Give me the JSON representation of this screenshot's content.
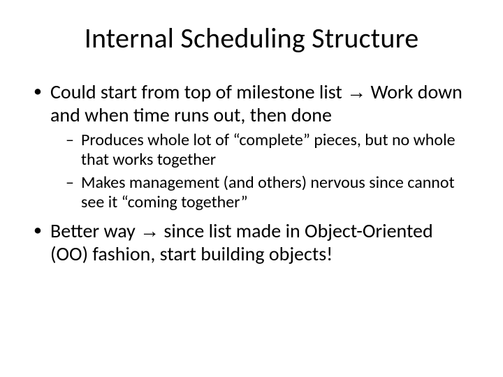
{
  "title": "Internal Scheduling Structure",
  "bullets": {
    "0": {
      "pre": "Could start from top of milestone list ",
      "arrow": "→",
      "post": " Work down and when time runs out, then done",
      "sub": {
        "0": "Produces whole lot of “complete” pieces, but no whole that works together",
        "1": "Makes management (and others) nervous since cannot see it “coming together”"
      }
    },
    "1": {
      "pre": "Better way ",
      "arrow": "→",
      "post": " since list made in Object-Oriented (OO) fashion, start building objects!"
    }
  }
}
